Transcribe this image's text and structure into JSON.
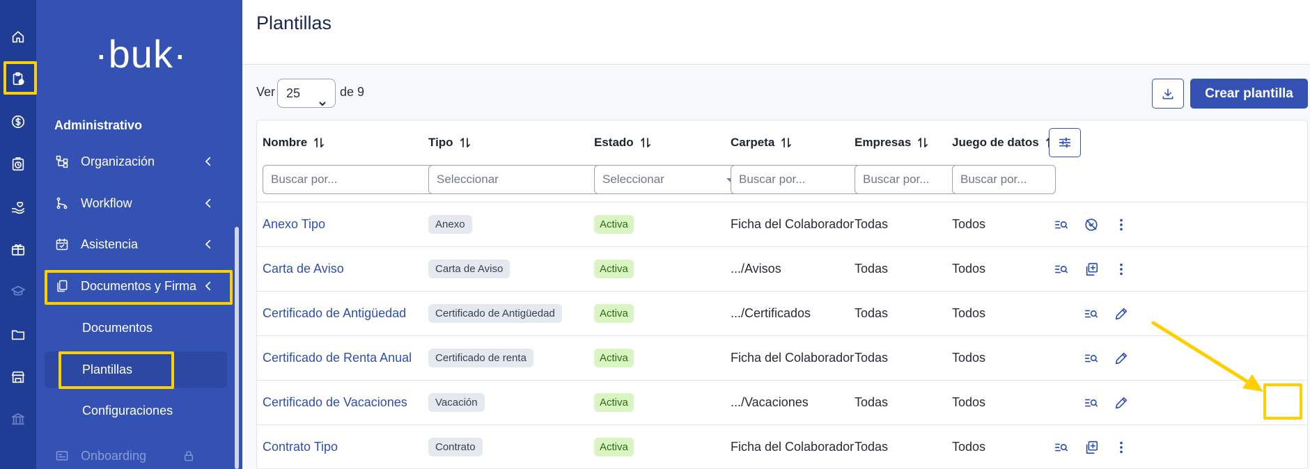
{
  "rail": {
    "icons": [
      "home-icon",
      "clipboard-icon",
      "dollar-icon",
      "stopwatch-icon",
      "hand-heart-icon",
      "gift-icon",
      "graduation-cap-icon",
      "folder-icon",
      "store-icon",
      "bank-icon"
    ]
  },
  "sidebar": {
    "logo": "·buk·",
    "section_title": "Administrativo",
    "items": [
      {
        "label": "Organización",
        "icon": "org-chart-icon"
      },
      {
        "label": "Workflow",
        "icon": "workflow-icon"
      },
      {
        "label": "Asistencia",
        "icon": "calendar-check-icon"
      },
      {
        "label": "Documentos y Firma",
        "icon": "documents-icon"
      }
    ],
    "subitems": [
      {
        "label": "Documentos"
      },
      {
        "label": "Plantillas"
      },
      {
        "label": "Configuraciones"
      }
    ],
    "locked_item": {
      "label": "Onboarding",
      "icon": "onboarding-icon"
    }
  },
  "page": {
    "title": "Plantillas",
    "ver_label": "Ver",
    "per_page_value": "25",
    "of_total": "de 9",
    "create_button": "Crear plantilla"
  },
  "table": {
    "headers": {
      "nombre": "Nombre",
      "tipo": "Tipo",
      "estado": "Estado",
      "carpeta": "Carpeta",
      "empresas": "Empresas",
      "juego": "Juego de datos"
    },
    "filters": {
      "nombre": "Buscar por...",
      "tipo": "Seleccionar",
      "estado": "Seleccionar",
      "carpeta": "Buscar por...",
      "empresas": "Buscar por...",
      "juego": "Buscar por..."
    },
    "rows": [
      {
        "nombre": "Anexo Tipo",
        "tipo": "Anexo",
        "estado": "Activa",
        "carpeta": "Ficha del Colaborador",
        "empresas": "Todas",
        "juego": "Todos"
      },
      {
        "nombre": "Carta de Aviso",
        "tipo": "Carta de Aviso",
        "estado": "Activa",
        "carpeta": ".../Avisos",
        "empresas": "Todas",
        "juego": "Todos"
      },
      {
        "nombre": "Certificado de Antigüedad",
        "tipo": "Certificado de Antigüedad",
        "estado": "Activa",
        "carpeta": ".../Certificados",
        "empresas": "Todas",
        "juego": "Todos"
      },
      {
        "nombre": "Certificado de Renta Anual",
        "tipo": "Certificado de renta",
        "estado": "Activa",
        "carpeta": "Ficha del Colaborador",
        "empresas": "Todas",
        "juego": "Todos"
      },
      {
        "nombre": "Certificado de Vacaciones",
        "tipo": "Vacación",
        "estado": "Activa",
        "carpeta": ".../Vacaciones",
        "empresas": "Todas",
        "juego": "Todos"
      },
      {
        "nombre": "Contrato Tipo",
        "tipo": "Contrato",
        "estado": "Activa",
        "carpeta": "Ficha del Colaborador",
        "empresas": "Todas",
        "juego": "Todos"
      }
    ]
  },
  "colors": {
    "rail": "#203d96",
    "sidebar": "#3452b4",
    "accent": "#3452b4",
    "highlight": "#ffd000",
    "status_green": "#daf5c3"
  }
}
